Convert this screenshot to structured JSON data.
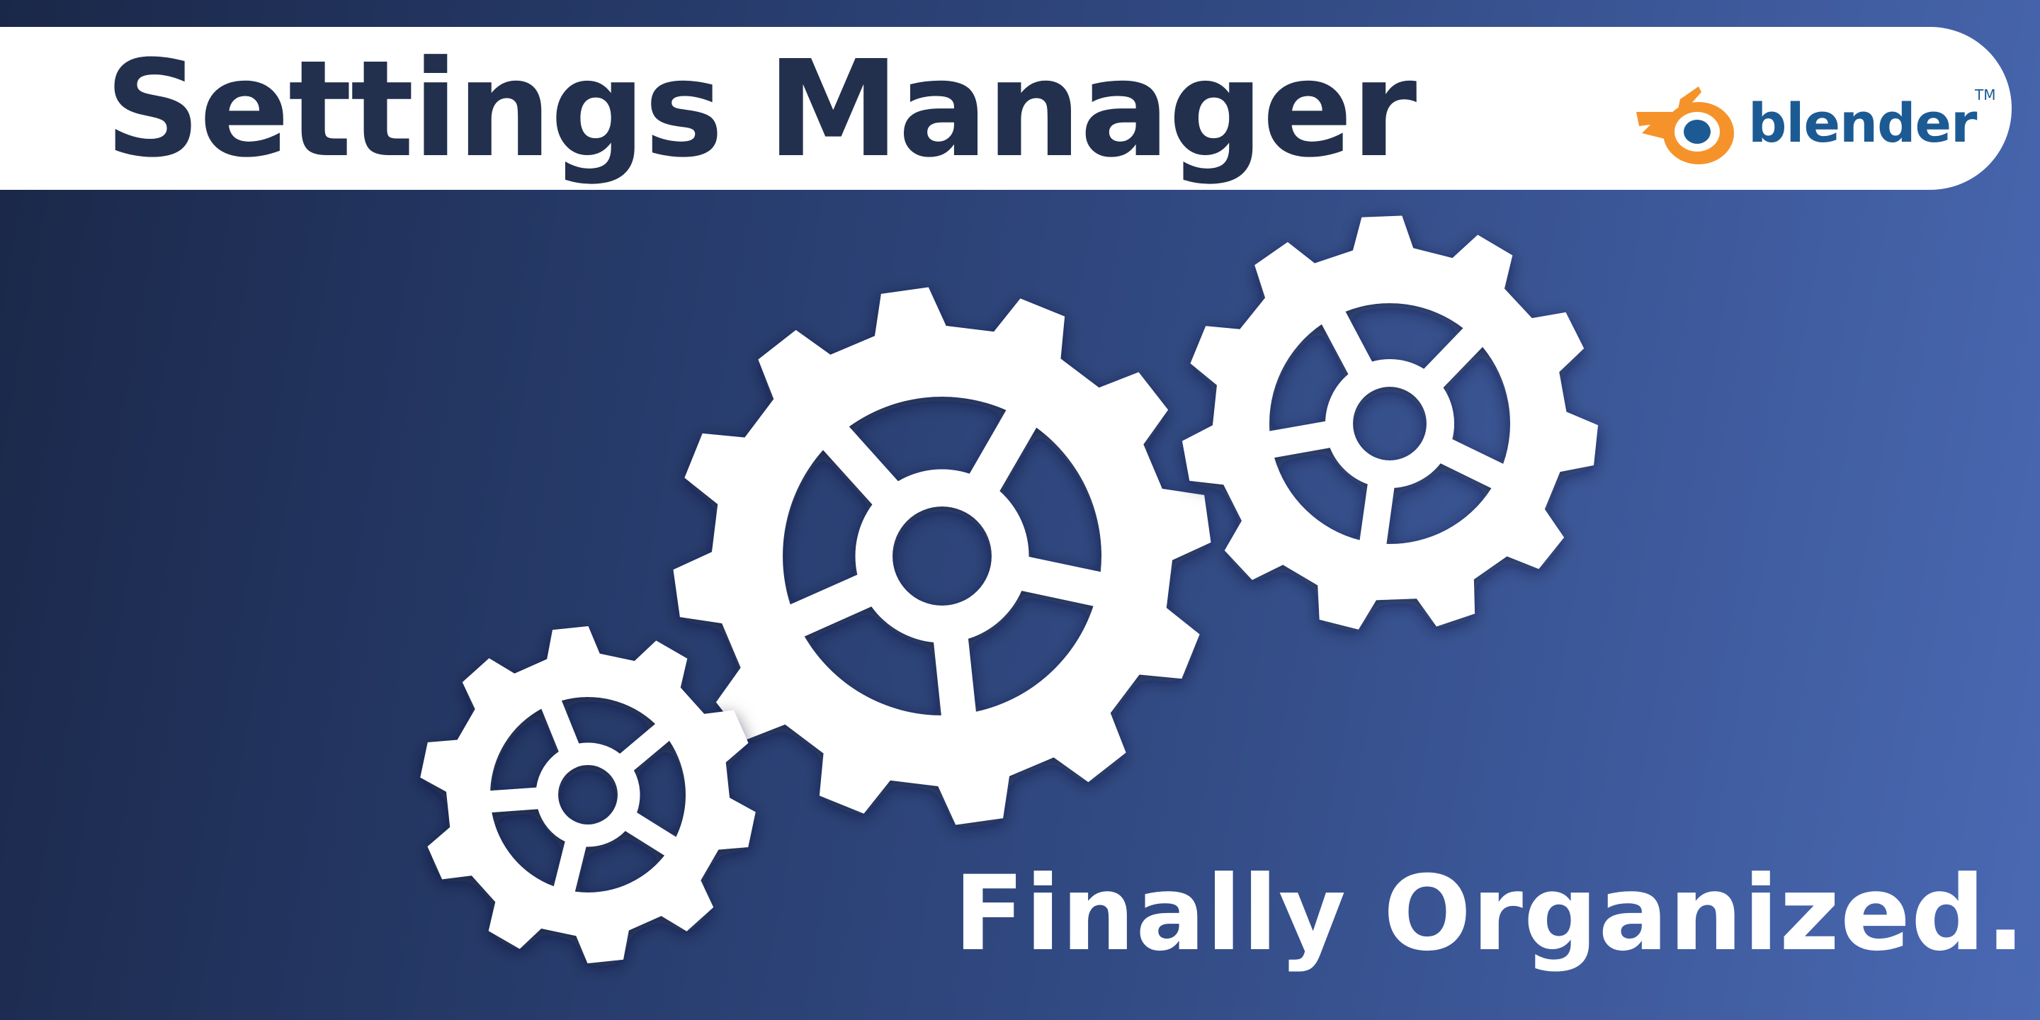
{
  "title": "Settings Manager",
  "tagline": "Finally Organized.",
  "brand": {
    "name": "blender",
    "trademark": "TM",
    "icon": "blender-logo-icon",
    "colors": {
      "orange": "#f5932a",
      "blue": "#1c5a94",
      "ring": "#ffffff"
    }
  },
  "gears": [
    {
      "name": "gear-large",
      "teeth": 12,
      "spokes": 5
    },
    {
      "name": "gear-medium",
      "teeth": 11,
      "spokes": 5
    },
    {
      "name": "gear-small",
      "teeth": 10,
      "spokes": 5
    }
  ],
  "colors": {
    "background_start": "#1a2748",
    "background_end": "#4a69b3",
    "banner": "#ffffff",
    "title_text": "#22304d",
    "gear": "#ffffff",
    "tagline_text": "#ffffff"
  }
}
